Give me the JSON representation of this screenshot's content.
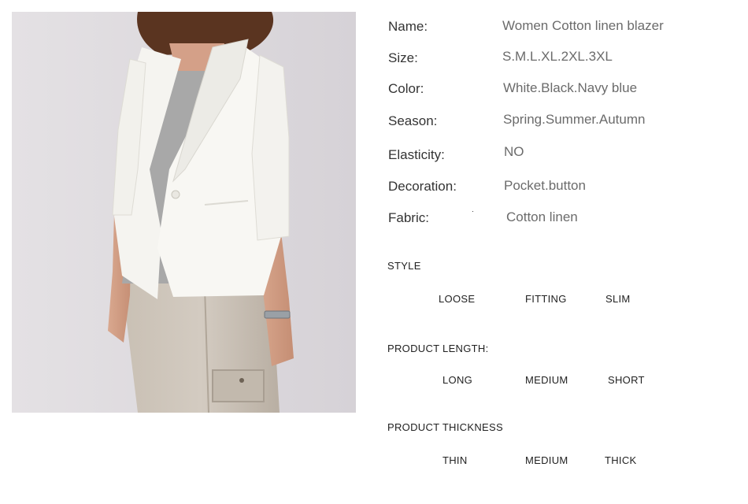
{
  "specs": {
    "name": {
      "label": "Name:",
      "value": "Women Cotton linen blazer"
    },
    "size": {
      "label": "Size:",
      "value": "S.M.L.XL.2XL.3XL"
    },
    "color": {
      "label": "Color:",
      "value": "White.Black.Navy blue"
    },
    "season": {
      "label": "Season:",
      "value": "Spring.Summer.Autumn"
    },
    "elasticity": {
      "label": "Elasticity:",
      "value": "NO"
    },
    "decoration": {
      "label": "Decoration:",
      "value": "Pocket.button"
    },
    "fabric": {
      "label": "Fabric:",
      "value": "Cotton linen"
    }
  },
  "style": {
    "title": "STYLE",
    "options": [
      "LOOSE",
      "FITTING",
      "SLIM"
    ]
  },
  "length": {
    "title": "PRODUCT LENGTH:",
    "options": [
      "LONG",
      "MEDIUM",
      "SHORT"
    ]
  },
  "thickness": {
    "title": "PRODUCT THICKNESS",
    "options": [
      "THIN",
      "MEDIUM",
      "THICK"
    ]
  },
  "colors": {
    "label_text": "#333333",
    "value_text": "#6b6b6b",
    "photo_background": "#ddd9dd",
    "blazer": "#f7f6f2",
    "tshirt": "#a8a8a8",
    "trousers": "#cbc2b8",
    "hair": "#5a3420"
  }
}
